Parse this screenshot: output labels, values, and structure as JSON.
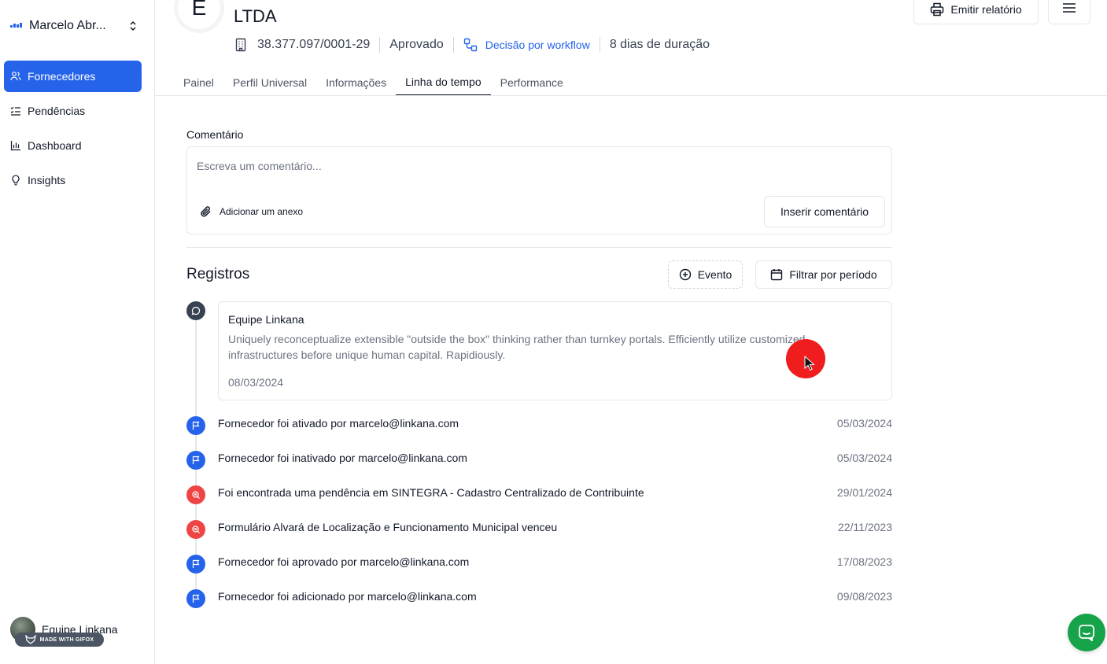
{
  "sidebar": {
    "org_name": "Marcelo Abr...",
    "items": [
      {
        "label": "Fornecedores",
        "icon": "users-icon",
        "active": true
      },
      {
        "label": "Pendências",
        "icon": "list-check-icon",
        "active": false
      },
      {
        "label": "Dashboard",
        "icon": "bar-chart-icon",
        "active": false
      },
      {
        "label": "Insights",
        "icon": "lightbulb-icon",
        "active": false
      }
    ],
    "user_name": "Equipe Linkana",
    "badge": "MADE WITH GIFOX"
  },
  "header": {
    "logo_letter": "E",
    "company_name": "LTDA",
    "cnpj": "38.377.097/0001-29",
    "status": "Aprovado",
    "workflow": "Decisão por workflow",
    "duration": "8 dias de duração",
    "report_button": "Emitir relatório"
  },
  "tabs": [
    {
      "label": "Painel",
      "active": false
    },
    {
      "label": "Perfil Universal",
      "active": false
    },
    {
      "label": "Informações",
      "active": false
    },
    {
      "label": "Linha do tempo",
      "active": true
    },
    {
      "label": "Performance",
      "active": false
    }
  ],
  "comment": {
    "label": "Comentário",
    "placeholder": "Escreva um comentário...",
    "attach_label": "Adicionar um anexo",
    "submit_label": "Inserir comentário"
  },
  "registros": {
    "title": "Registros",
    "event_button": "Evento",
    "filter_button": "Filtrar por período",
    "comment_card": {
      "author": "Equipe Linkana",
      "text": "Uniquely reconceptualize extensible \"outside the box\" thinking rather than turnkey portals. Efficiently utilize customized infrastructures before unique human capital. Rapidiously.",
      "date": "08/03/2024"
    },
    "events": [
      {
        "text": "Fornecedor foi ativado por marcelo@linkana.com",
        "date": "05/03/2024",
        "type": "flag",
        "color": "#2563eb"
      },
      {
        "text": "Fornecedor foi inativado por marcelo@linkana.com",
        "date": "05/03/2024",
        "type": "flag",
        "color": "#2563eb"
      },
      {
        "text": "Foi encontrada uma pendência em SINTEGRA - Cadastro Centralizado de Contribuinte",
        "date": "29/01/2024",
        "type": "alert",
        "color": "#ef4444"
      },
      {
        "text": "Formulário Alvará de Localização e Funcionamento Municipal venceu",
        "date": "22/11/2023",
        "type": "alert",
        "color": "#ef4444"
      },
      {
        "text": "Fornecedor foi aprovado por marcelo@linkana.com",
        "date": "17/08/2023",
        "type": "flag",
        "color": "#2563eb"
      },
      {
        "text": "Fornecedor foi adicionado por marcelo@linkana.com",
        "date": "09/08/2023",
        "type": "flag",
        "color": "#2563eb"
      }
    ]
  },
  "colors": {
    "primary": "#2563eb",
    "danger": "#ef4444",
    "chat": "#16a34a"
  }
}
